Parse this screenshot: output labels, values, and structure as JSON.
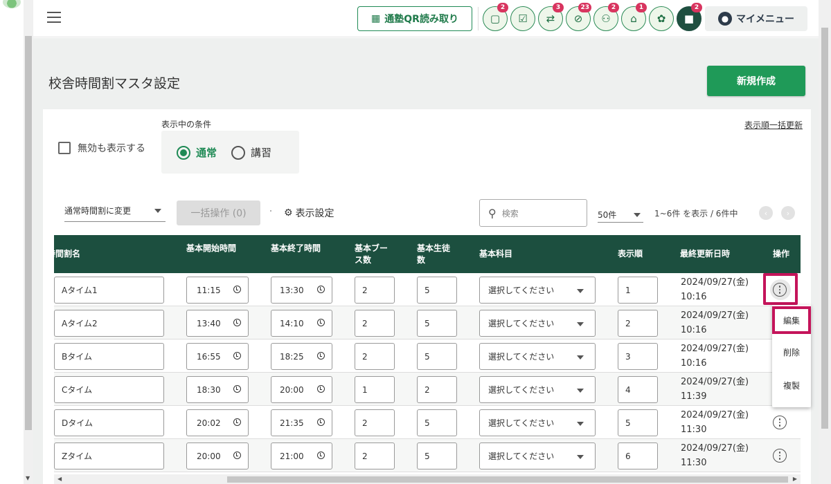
{
  "header": {
    "qr_button": "通塾QR読み取り",
    "icons": [
      {
        "name": "chat-bubble-icon",
        "glyph": "▢",
        "badge": "2"
      },
      {
        "name": "checklist-icon",
        "glyph": "☑",
        "badge": ""
      },
      {
        "name": "transfer-arrows-icon",
        "glyph": "⇄",
        "badge": "3"
      },
      {
        "name": "no-attendance-icon",
        "glyph": "⊘",
        "badge": "23"
      },
      {
        "name": "group-icon",
        "glyph": "⚇",
        "badge": "2"
      },
      {
        "name": "school-building-icon",
        "glyph": "⌂",
        "badge": "1"
      },
      {
        "name": "gift-icon",
        "glyph": "✿",
        "badge": ""
      },
      {
        "name": "message-icon",
        "glyph": "■",
        "badge": "2"
      }
    ],
    "my_menu": "マイメニュー"
  },
  "page": {
    "title": "校舎時間割マスタ設定",
    "new_button": "新規作成",
    "bulk_update_link": "表示順一括更新",
    "show_invalid_label": "無効も表示する",
    "condition_label": "表示中の条件",
    "radio_normal": "通常",
    "radio_course": "講習"
  },
  "toolbar": {
    "change_select": "通常時間割に変更",
    "bulk_operation": "一括操作 (0)",
    "display_settings": "表示設定",
    "search_placeholder": "検索",
    "per_page": "50件",
    "range_text": "1~6件 を表示 / 6件中"
  },
  "table": {
    "headers": {
      "name": "時間割名",
      "start": "基本開始時間",
      "end": "基本終了時間",
      "booths": "基本ブー\nス数",
      "students": "基本生徒\n数",
      "subject": "基本科目",
      "order": "表示順",
      "updated": "最終更新日時",
      "actions": "操作"
    },
    "rows": [
      {
        "name": "Aタイム1",
        "start": "11:15",
        "end": "13:30",
        "booths": "2",
        "students": "5",
        "subject": "選択してください",
        "order": "1",
        "updated_date": "2024/09/27(金)",
        "updated_time": "10:16"
      },
      {
        "name": "Aタイム2",
        "start": "13:40",
        "end": "14:10",
        "booths": "2",
        "students": "5",
        "subject": "選択してください",
        "order": "2",
        "updated_date": "2024/09/27(金)",
        "updated_time": "10:16"
      },
      {
        "name": "Bタイム",
        "start": "16:55",
        "end": "18:25",
        "booths": "2",
        "students": "5",
        "subject": "選択してください",
        "order": "3",
        "updated_date": "2024/09/27(金)",
        "updated_time": "10:16"
      },
      {
        "name": "Cタイム",
        "start": "18:30",
        "end": "20:00",
        "booths": "1",
        "students": "2",
        "subject": "選択してください",
        "order": "4",
        "updated_date": "2024/09/27(金)",
        "updated_time": "11:39"
      },
      {
        "name": "Dタイム",
        "start": "20:02",
        "end": "21:35",
        "booths": "2",
        "students": "5",
        "subject": "選択してください",
        "order": "5",
        "updated_date": "2024/09/27(金)",
        "updated_time": "11:30"
      },
      {
        "name": "Zタイム",
        "start": "20:00",
        "end": "21:00",
        "booths": "2",
        "students": "5",
        "subject": "選択してください",
        "order": "6",
        "updated_date": "2024/09/27(金)",
        "updated_time": "11:30"
      }
    ]
  },
  "context_menu": {
    "edit": "編集",
    "delete": "削除",
    "duplicate": "複製"
  },
  "colors": {
    "brand_green": "#1f9a58",
    "table_header": "#1c4f3f",
    "highlight": "#c4145a",
    "badge": "#d8345f"
  }
}
